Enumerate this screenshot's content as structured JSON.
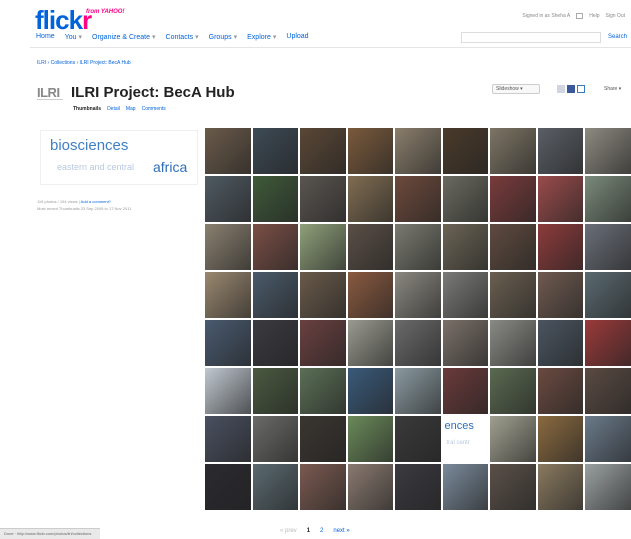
{
  "brand": {
    "logo_blue": "flick",
    "logo_pink": "r",
    "tagline": "from YAHOO!",
    "colors": {
      "blue": "#0063dc",
      "pink": "#ff0084"
    }
  },
  "nav": {
    "items": [
      {
        "label": "Home",
        "has_menu": false
      },
      {
        "label": "You",
        "has_menu": true
      },
      {
        "label": "Organize & Create",
        "has_menu": true
      },
      {
        "label": "Contacts",
        "has_menu": true
      },
      {
        "label": "Groups",
        "has_menu": true
      },
      {
        "label": "Explore",
        "has_menu": true
      },
      {
        "label": "Upload",
        "has_menu": false
      }
    ],
    "caret": "▾"
  },
  "toplinks": {
    "signed_in": "Signed in as Sheha A",
    "inbox_icon": "mail-icon",
    "help": "Help",
    "sign_out": "Sign Out",
    "search_label": "Search"
  },
  "breadcrumb": "ILRI › Collections › ILRI Project: BecA Hub",
  "header": {
    "owner_logo": "ILRI",
    "title": "ILRI Project: BecA Hub",
    "tabs": [
      {
        "label": "Thumbnails",
        "active": true
      },
      {
        "label": "Detail",
        "active": false
      },
      {
        "label": "Map",
        "active": false
      },
      {
        "label": "Comments",
        "active": false
      }
    ],
    "slideshow": "Slideshow ▾",
    "share": "Share ▾"
  },
  "collection_logo": {
    "line1": "biosciences",
    "line2": "eastern and central",
    "line3": "africa"
  },
  "meta": {
    "count_text": "116 photos / 104 views |",
    "edit_link": "Add a comment?",
    "created_text": "Most recent Thumbnails 23 Sep 2009 to 17 Nov 2011"
  },
  "thumb_colors": [
    [
      "#6b5b4a",
      "#3d4a55",
      "#5a4736",
      "#7a5a3c",
      "#8a7e6c",
      "#4a3a2a",
      "#7d7565",
      "#5a5f66",
      "#8d8a80"
    ],
    [
      "#4f5a62",
      "#3f5a3a",
      "#5a5550",
      "#806d52",
      "#6d4a3c",
      "#6a6a60",
      "#7a3b3b",
      "#9a4b4b",
      "#7a8a7a"
    ],
    [
      "#8a8070",
      "#7a4f45",
      "#8fa07a",
      "#5a4f46",
      "#7a7a70",
      "#6b6455",
      "#5f4a3f",
      "#8d3b3b",
      "#6a6f78"
    ],
    [
      "#9a8870",
      "#4a5a6a",
      "#6a5a4a",
      "#8a5a40",
      "#8a8880",
      "#7a7a78",
      "#6a5f50",
      "#6f5a50",
      "#5a6a70"
    ],
    [
      "#4a5a70",
      "#3a3a40",
      "#6a4040",
      "#9a9a90",
      "#6a6a6a",
      "#7a7068",
      "#8a8a85",
      "#4a5560",
      "#9a3a3a"
    ],
    [
      "#c0c8d0",
      "#4a5a40",
      "#5a6f55",
      "#3a5a7a",
      "#8a9aa0",
      "#6a3a3a",
      "#5a6a50",
      "#6a4a40",
      "#5a4a42"
    ],
    [
      "#4a5060",
      "#6a6a68",
      "#3a3530",
      "#6a8a5a",
      "#3a3a3a",
      "#text",
      "#a0a090",
      "#8a6a40",
      "#6a7a8a"
    ],
    [
      "#2a2a30",
      "#5a6a70",
      "#7a5a50",
      "#8a7a70",
      "#3a3a40",
      "#7a8a9a",
      "#5a5048",
      "#8a7a60",
      "#9aa0a0"
    ]
  ],
  "text_tile": {
    "line1": "ences",
    "line2": "tral  centr"
  },
  "pager": {
    "prev": "« prev",
    "page1": "1",
    "page2": "2",
    "next": "next »"
  },
  "status": "Done · http://www.flickr.com/photos/ilri/collections"
}
